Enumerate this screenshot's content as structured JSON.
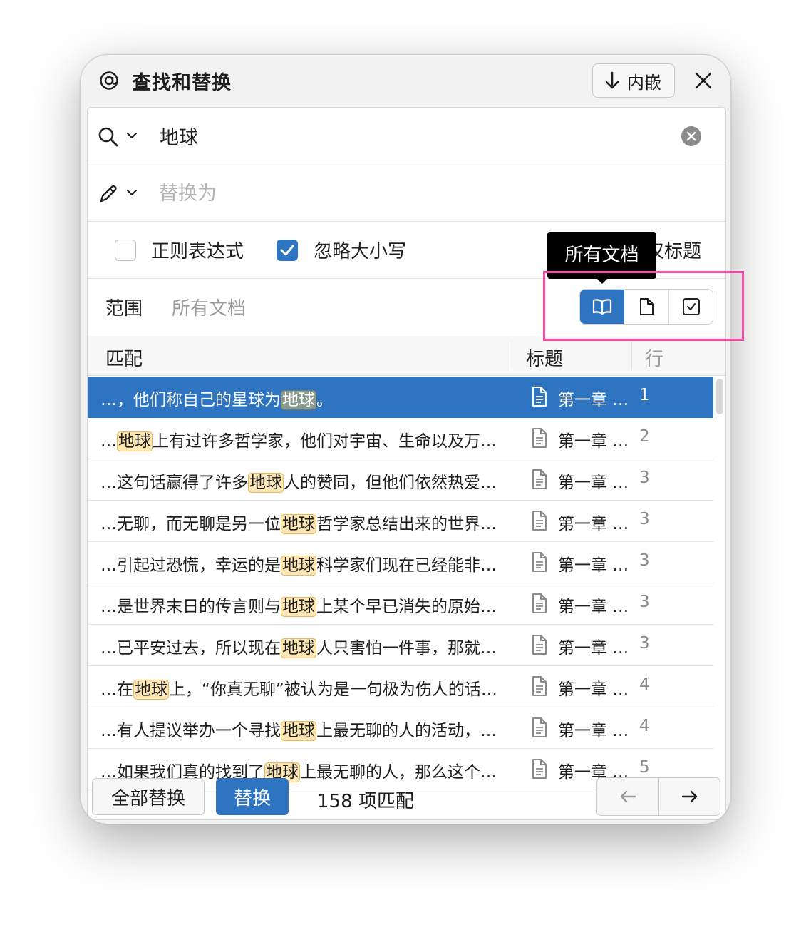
{
  "window": {
    "title": "查找和替换",
    "embed_label": "内嵌"
  },
  "search": {
    "value": "地球"
  },
  "replace": {
    "placeholder": "替换为"
  },
  "options": {
    "regex_label": "正则表达式",
    "regex_checked": false,
    "ignore_case_label": "忽略大小写",
    "ignore_case_checked": true,
    "titles_only_label": "仅标题"
  },
  "scope": {
    "label": "范围",
    "value": "所有文档",
    "tooltip": "所有文档"
  },
  "table": {
    "headers": {
      "match": "匹配",
      "title": "标题",
      "line": "行"
    },
    "rows": [
      {
        "before": "…，他们称自己的星球为",
        "hit": "地球",
        "after": "。",
        "title": "第一章 …",
        "line": "1",
        "selected": true
      },
      {
        "before": "…",
        "hit": "地球",
        "after": "上有过许多哲学家，他们对宇宙、生命以及万…",
        "title": "第一章 …",
        "line": "2"
      },
      {
        "before": "…这句话赢得了许多",
        "hit": "地球",
        "after": "人的赞同，但他们依然热爱…",
        "title": "第一章 …",
        "line": "3"
      },
      {
        "before": "…无聊，而无聊是另一位",
        "hit": "地球",
        "after": "哲学家总结出来的世界…",
        "title": "第一章 …",
        "line": "3"
      },
      {
        "before": "…引起过恐慌，幸运的是",
        "hit": "地球",
        "after": "科学家们现在已经能非…",
        "title": "第一章 …",
        "line": "3"
      },
      {
        "before": "…是世界末日的传言则与",
        "hit": "地球",
        "after": "上某个早已消失的原始…",
        "title": "第一章 …",
        "line": "3"
      },
      {
        "before": "…已平安过去，所以现在",
        "hit": "地球",
        "after": "人只害怕一件事，那就…",
        "title": "第一章 …",
        "line": "3"
      },
      {
        "before": "…在",
        "hit": "地球",
        "after": "上，“你真无聊”被认为是一句极为伤人的话…",
        "title": "第一章 …",
        "line": "4"
      },
      {
        "before": "…有人提议举办一个寻找",
        "hit": "地球",
        "after": "上最无聊的人的活动，…",
        "title": "第一章 …",
        "line": "4"
      },
      {
        "before": "…如果我们真的找到了",
        "hit": "地球",
        "after": "上最无聊的人，那么这个…",
        "title": "第一章 …",
        "line": "5"
      }
    ]
  },
  "footer": {
    "replace_all": "全部替换",
    "replace": "替换",
    "match_count": "158 项匹配"
  },
  "colors": {
    "accent": "#2f74c0",
    "highlight": "#fbe6b4",
    "annotation": "#f54aa8"
  }
}
